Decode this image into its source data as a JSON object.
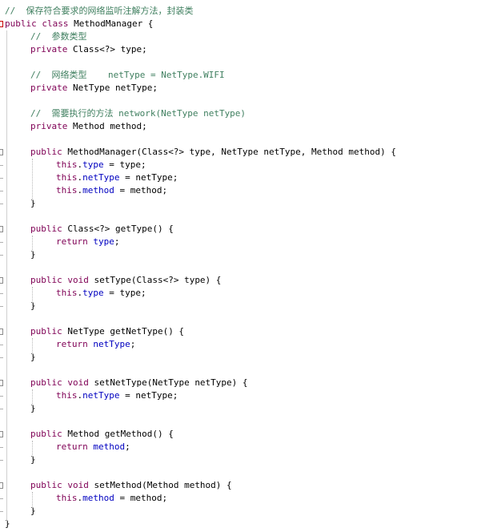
{
  "editor": {
    "language": "java",
    "colors": {
      "keyword": "#7f0055",
      "field": "#0000c0",
      "comment": "#3f7f5f",
      "text": "#000000",
      "background": "#ffffff"
    },
    "lines": [
      {
        "indent": 0,
        "marker": "",
        "tokens": [
          {
            "c": "comment",
            "t": "//  保存符合要求的网络监听注解方法，封装类"
          }
        ]
      },
      {
        "indent": 0,
        "marker": "fold-red",
        "tokens": [
          {
            "c": "kw",
            "t": "public class "
          },
          {
            "c": "plain",
            "t": "MethodManager {"
          }
        ]
      },
      {
        "indent": 1,
        "marker": "",
        "tokens": [
          {
            "c": "comment",
            "t": "//  参数类型"
          }
        ]
      },
      {
        "indent": 1,
        "marker": "",
        "tokens": [
          {
            "c": "kw",
            "t": "private "
          },
          {
            "c": "plain",
            "t": "Class<?> type;"
          }
        ]
      },
      {
        "indent": 1,
        "marker": "",
        "tokens": []
      },
      {
        "indent": 1,
        "marker": "",
        "tokens": [
          {
            "c": "comment",
            "t": "//  网络类型    netType = NetType.WIFI"
          }
        ]
      },
      {
        "indent": 1,
        "marker": "",
        "tokens": [
          {
            "c": "kw",
            "t": "private "
          },
          {
            "c": "plain",
            "t": "NetType netType;"
          }
        ]
      },
      {
        "indent": 1,
        "marker": "",
        "tokens": []
      },
      {
        "indent": 1,
        "marker": "",
        "tokens": [
          {
            "c": "comment",
            "t": "//  需要执行的方法 network(NetType netType)"
          }
        ]
      },
      {
        "indent": 1,
        "marker": "",
        "tokens": [
          {
            "c": "kw",
            "t": "private "
          },
          {
            "c": "plain",
            "t": "Method method;"
          }
        ]
      },
      {
        "indent": 1,
        "marker": "",
        "tokens": []
      },
      {
        "indent": 1,
        "marker": "fold",
        "tokens": [
          {
            "c": "kw",
            "t": "public "
          },
          {
            "c": "plain",
            "t": "MethodManager(Class<?> type, NetType netType, Method method) {"
          }
        ]
      },
      {
        "indent": 2,
        "marker": "",
        "tokens": [
          {
            "c": "kw",
            "t": "this"
          },
          {
            "c": "plain",
            "t": "."
          },
          {
            "c": "field",
            "t": "type"
          },
          {
            "c": "plain",
            "t": " = type;"
          }
        ]
      },
      {
        "indent": 2,
        "marker": "",
        "tokens": [
          {
            "c": "kw",
            "t": "this"
          },
          {
            "c": "plain",
            "t": "."
          },
          {
            "c": "field",
            "t": "netType"
          },
          {
            "c": "plain",
            "t": " = netType;"
          }
        ]
      },
      {
        "indent": 2,
        "marker": "",
        "tokens": [
          {
            "c": "kw",
            "t": "this"
          },
          {
            "c": "plain",
            "t": "."
          },
          {
            "c": "field",
            "t": "method"
          },
          {
            "c": "plain",
            "t": " = method;"
          }
        ]
      },
      {
        "indent": 1,
        "marker": "",
        "tokens": [
          {
            "c": "plain",
            "t": "}"
          }
        ]
      },
      {
        "indent": 1,
        "marker": "",
        "tokens": []
      },
      {
        "indent": 1,
        "marker": "fold",
        "tokens": [
          {
            "c": "kw",
            "t": "public "
          },
          {
            "c": "plain",
            "t": "Class<?> getType() {"
          }
        ]
      },
      {
        "indent": 2,
        "marker": "",
        "tokens": [
          {
            "c": "kw",
            "t": "return "
          },
          {
            "c": "field",
            "t": "type"
          },
          {
            "c": "plain",
            "t": ";"
          }
        ]
      },
      {
        "indent": 1,
        "marker": "",
        "tokens": [
          {
            "c": "plain",
            "t": "}"
          }
        ]
      },
      {
        "indent": 1,
        "marker": "",
        "tokens": []
      },
      {
        "indent": 1,
        "marker": "fold",
        "tokens": [
          {
            "c": "kw",
            "t": "public void "
          },
          {
            "c": "plain",
            "t": "setType(Class<?> type) {"
          }
        ]
      },
      {
        "indent": 2,
        "marker": "",
        "tokens": [
          {
            "c": "kw",
            "t": "this"
          },
          {
            "c": "plain",
            "t": "."
          },
          {
            "c": "field",
            "t": "type"
          },
          {
            "c": "plain",
            "t": " = type;"
          }
        ]
      },
      {
        "indent": 1,
        "marker": "",
        "tokens": [
          {
            "c": "plain",
            "t": "}"
          }
        ]
      },
      {
        "indent": 1,
        "marker": "",
        "tokens": []
      },
      {
        "indent": 1,
        "marker": "fold",
        "tokens": [
          {
            "c": "kw",
            "t": "public "
          },
          {
            "c": "plain",
            "t": "NetType getNetType() {"
          }
        ]
      },
      {
        "indent": 2,
        "marker": "",
        "tokens": [
          {
            "c": "kw",
            "t": "return "
          },
          {
            "c": "field",
            "t": "netType"
          },
          {
            "c": "plain",
            "t": ";"
          }
        ]
      },
      {
        "indent": 1,
        "marker": "",
        "tokens": [
          {
            "c": "plain",
            "t": "}"
          }
        ]
      },
      {
        "indent": 1,
        "marker": "",
        "tokens": []
      },
      {
        "indent": 1,
        "marker": "fold",
        "tokens": [
          {
            "c": "kw",
            "t": "public void "
          },
          {
            "c": "plain",
            "t": "setNetType(NetType netType) {"
          }
        ]
      },
      {
        "indent": 2,
        "marker": "",
        "tokens": [
          {
            "c": "kw",
            "t": "this"
          },
          {
            "c": "plain",
            "t": "."
          },
          {
            "c": "field",
            "t": "netType"
          },
          {
            "c": "plain",
            "t": " = netType;"
          }
        ]
      },
      {
        "indent": 1,
        "marker": "",
        "tokens": [
          {
            "c": "plain",
            "t": "}"
          }
        ]
      },
      {
        "indent": 1,
        "marker": "",
        "tokens": []
      },
      {
        "indent": 1,
        "marker": "fold",
        "tokens": [
          {
            "c": "kw",
            "t": "public "
          },
          {
            "c": "plain",
            "t": "Method getMethod() {"
          }
        ]
      },
      {
        "indent": 2,
        "marker": "",
        "tokens": [
          {
            "c": "kw",
            "t": "return "
          },
          {
            "c": "field",
            "t": "method"
          },
          {
            "c": "plain",
            "t": ";"
          }
        ]
      },
      {
        "indent": 1,
        "marker": "",
        "tokens": [
          {
            "c": "plain",
            "t": "}"
          }
        ]
      },
      {
        "indent": 1,
        "marker": "",
        "tokens": []
      },
      {
        "indent": 1,
        "marker": "fold",
        "tokens": [
          {
            "c": "kw",
            "t": "public void "
          },
          {
            "c": "plain",
            "t": "setMethod(Method method) {"
          }
        ]
      },
      {
        "indent": 2,
        "marker": "",
        "tokens": [
          {
            "c": "kw",
            "t": "this"
          },
          {
            "c": "plain",
            "t": "."
          },
          {
            "c": "field",
            "t": "method"
          },
          {
            "c": "plain",
            "t": " = method;"
          }
        ]
      },
      {
        "indent": 1,
        "marker": "",
        "tokens": [
          {
            "c": "plain",
            "t": "}"
          }
        ]
      },
      {
        "indent": 0,
        "marker": "",
        "tokens": [
          {
            "c": "plain",
            "t": "}"
          }
        ]
      }
    ]
  }
}
